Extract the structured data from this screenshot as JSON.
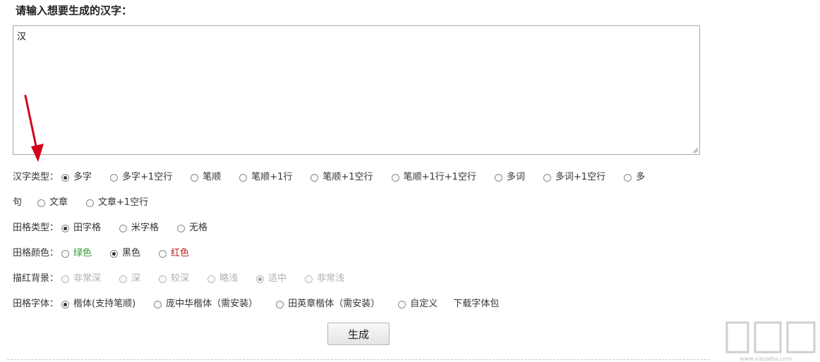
{
  "heading": "请输入想要生成的汉字：",
  "textarea": {
    "value": "汉"
  },
  "hanzi_type": {
    "label": "汉字类型：",
    "options": [
      "多字",
      "多字+1空行",
      "笔顺",
      "笔顺+1行",
      "笔顺+1空行",
      "笔顺+1行+1空行",
      "多词",
      "多词+1空行",
      "多"
    ],
    "wrap_text": "句",
    "options_line2": [
      "文章",
      "文章+1空行"
    ],
    "selected": "多字"
  },
  "grid_type": {
    "label": "田格类型：",
    "options": [
      "田字格",
      "米字格",
      "无格"
    ],
    "selected": "田字格"
  },
  "grid_color": {
    "label": "田格颜色：",
    "options": [
      "绿色",
      "黑色",
      "红色"
    ],
    "selected": "黑色",
    "colors": {
      "green": "#2e9b2e",
      "black": "#333333",
      "red": "#b22222"
    }
  },
  "trace_bg": {
    "label": "描红背景：",
    "options": [
      "非常深",
      "深",
      "较深",
      "略浅",
      "适中",
      "非常浅"
    ],
    "selected": "适中"
  },
  "grid_font": {
    "label": "田格字体：",
    "options": [
      "楷体(支持笔顺)",
      "庞中华楷体（需安装）",
      "田英章楷体（需安装）",
      "自定义"
    ],
    "selected": "楷体(支持笔顺)",
    "download_link": "下载字体包"
  },
  "generate_button": "生成",
  "watermark": {
    "text": "下载吧",
    "url_text": "www.xiazaiba.com"
  },
  "accent_arrow_color": "#d0021b"
}
